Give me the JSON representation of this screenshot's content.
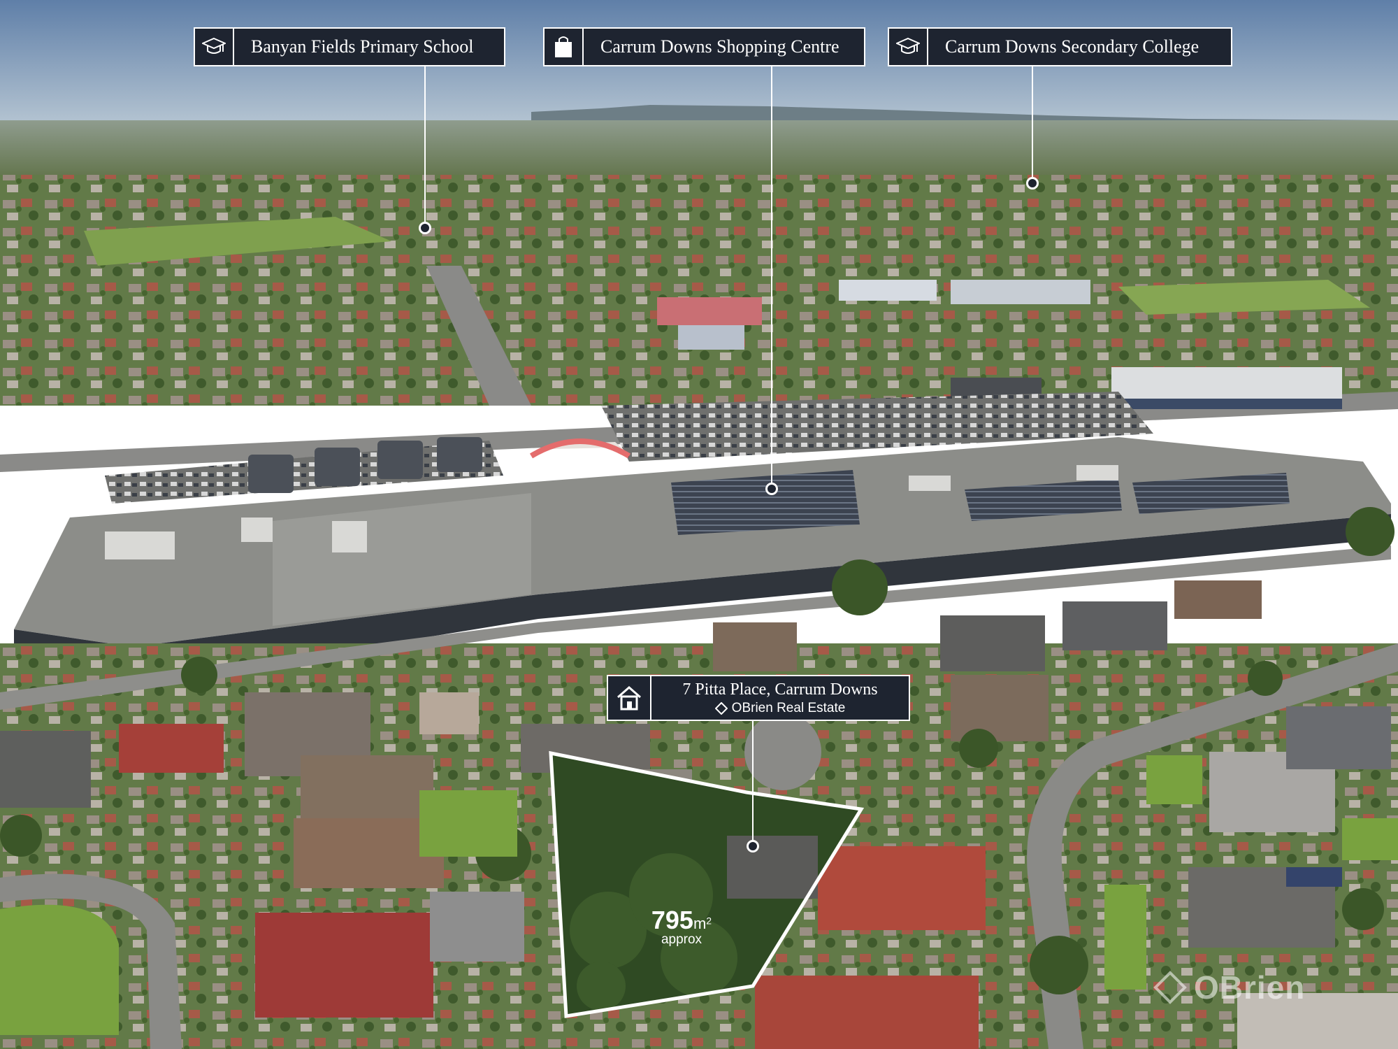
{
  "photo": {
    "kind": "aerial real-estate photograph",
    "colors": {
      "sky_top": "#5f7fa8",
      "sky_horizon": "#a9bccd",
      "vegetation": "#4f6b3a",
      "roof_grey": "#8d8d8a",
      "roof_red": "#a0413a",
      "label_bg": "#1e2430",
      "outline": "#ffffff"
    }
  },
  "poi_labels": [
    {
      "icon": "graduation-cap-icon",
      "text": "Banyan Fields Primary School"
    },
    {
      "icon": "shopping-bag-icon",
      "text": "Carrum Downs Shopping Centre"
    },
    {
      "icon": "graduation-cap-icon",
      "text": "Carrum Downs Secondary College"
    }
  ],
  "property": {
    "address": "7 Pitta Place, Carrum Downs",
    "agent": "OBrien Real Estate",
    "icon": "house-icon"
  },
  "land": {
    "area_value": "795",
    "area_unit": "m",
    "area_unit_sup": "2",
    "area_note": "approx"
  },
  "watermark": {
    "text": "OBrien"
  }
}
